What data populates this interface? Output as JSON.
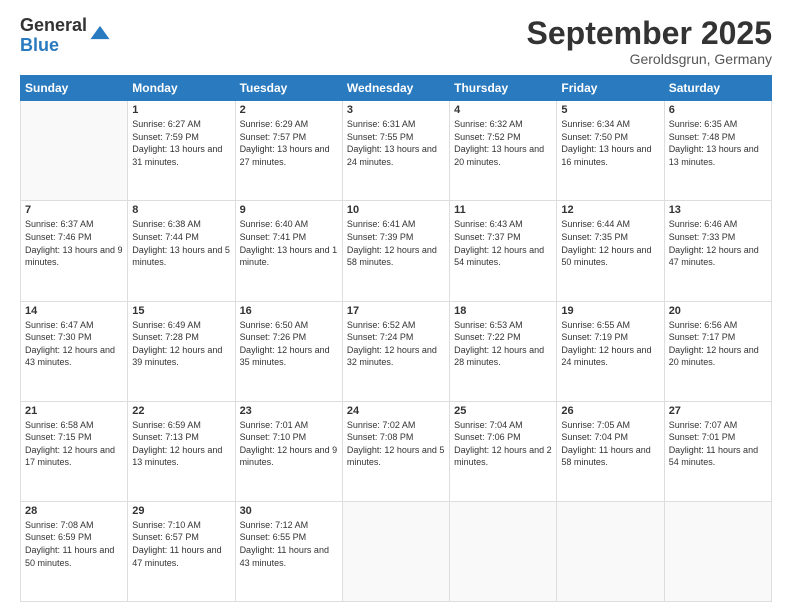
{
  "header": {
    "logo_general": "General",
    "logo_blue": "Blue",
    "month_title": "September 2025",
    "location": "Geroldsgrun, Germany"
  },
  "days_of_week": [
    "Sunday",
    "Monday",
    "Tuesday",
    "Wednesday",
    "Thursday",
    "Friday",
    "Saturday"
  ],
  "weeks": [
    [
      {
        "day": "",
        "info": ""
      },
      {
        "day": "1",
        "info": "Sunrise: 6:27 AM\nSunset: 7:59 PM\nDaylight: 13 hours and 31 minutes."
      },
      {
        "day": "2",
        "info": "Sunrise: 6:29 AM\nSunset: 7:57 PM\nDaylight: 13 hours and 27 minutes."
      },
      {
        "day": "3",
        "info": "Sunrise: 6:31 AM\nSunset: 7:55 PM\nDaylight: 13 hours and 24 minutes."
      },
      {
        "day": "4",
        "info": "Sunrise: 6:32 AM\nSunset: 7:52 PM\nDaylight: 13 hours and 20 minutes."
      },
      {
        "day": "5",
        "info": "Sunrise: 6:34 AM\nSunset: 7:50 PM\nDaylight: 13 hours and 16 minutes."
      },
      {
        "day": "6",
        "info": "Sunrise: 6:35 AM\nSunset: 7:48 PM\nDaylight: 13 hours and 13 minutes."
      }
    ],
    [
      {
        "day": "7",
        "info": "Sunrise: 6:37 AM\nSunset: 7:46 PM\nDaylight: 13 hours and 9 minutes."
      },
      {
        "day": "8",
        "info": "Sunrise: 6:38 AM\nSunset: 7:44 PM\nDaylight: 13 hours and 5 minutes."
      },
      {
        "day": "9",
        "info": "Sunrise: 6:40 AM\nSunset: 7:41 PM\nDaylight: 13 hours and 1 minute."
      },
      {
        "day": "10",
        "info": "Sunrise: 6:41 AM\nSunset: 7:39 PM\nDaylight: 12 hours and 58 minutes."
      },
      {
        "day": "11",
        "info": "Sunrise: 6:43 AM\nSunset: 7:37 PM\nDaylight: 12 hours and 54 minutes."
      },
      {
        "day": "12",
        "info": "Sunrise: 6:44 AM\nSunset: 7:35 PM\nDaylight: 12 hours and 50 minutes."
      },
      {
        "day": "13",
        "info": "Sunrise: 6:46 AM\nSunset: 7:33 PM\nDaylight: 12 hours and 47 minutes."
      }
    ],
    [
      {
        "day": "14",
        "info": "Sunrise: 6:47 AM\nSunset: 7:30 PM\nDaylight: 12 hours and 43 minutes."
      },
      {
        "day": "15",
        "info": "Sunrise: 6:49 AM\nSunset: 7:28 PM\nDaylight: 12 hours and 39 minutes."
      },
      {
        "day": "16",
        "info": "Sunrise: 6:50 AM\nSunset: 7:26 PM\nDaylight: 12 hours and 35 minutes."
      },
      {
        "day": "17",
        "info": "Sunrise: 6:52 AM\nSunset: 7:24 PM\nDaylight: 12 hours and 32 minutes."
      },
      {
        "day": "18",
        "info": "Sunrise: 6:53 AM\nSunset: 7:22 PM\nDaylight: 12 hours and 28 minutes."
      },
      {
        "day": "19",
        "info": "Sunrise: 6:55 AM\nSunset: 7:19 PM\nDaylight: 12 hours and 24 minutes."
      },
      {
        "day": "20",
        "info": "Sunrise: 6:56 AM\nSunset: 7:17 PM\nDaylight: 12 hours and 20 minutes."
      }
    ],
    [
      {
        "day": "21",
        "info": "Sunrise: 6:58 AM\nSunset: 7:15 PM\nDaylight: 12 hours and 17 minutes."
      },
      {
        "day": "22",
        "info": "Sunrise: 6:59 AM\nSunset: 7:13 PM\nDaylight: 12 hours and 13 minutes."
      },
      {
        "day": "23",
        "info": "Sunrise: 7:01 AM\nSunset: 7:10 PM\nDaylight: 12 hours and 9 minutes."
      },
      {
        "day": "24",
        "info": "Sunrise: 7:02 AM\nSunset: 7:08 PM\nDaylight: 12 hours and 5 minutes."
      },
      {
        "day": "25",
        "info": "Sunrise: 7:04 AM\nSunset: 7:06 PM\nDaylight: 12 hours and 2 minutes."
      },
      {
        "day": "26",
        "info": "Sunrise: 7:05 AM\nSunset: 7:04 PM\nDaylight: 11 hours and 58 minutes."
      },
      {
        "day": "27",
        "info": "Sunrise: 7:07 AM\nSunset: 7:01 PM\nDaylight: 11 hours and 54 minutes."
      }
    ],
    [
      {
        "day": "28",
        "info": "Sunrise: 7:08 AM\nSunset: 6:59 PM\nDaylight: 11 hours and 50 minutes."
      },
      {
        "day": "29",
        "info": "Sunrise: 7:10 AM\nSunset: 6:57 PM\nDaylight: 11 hours and 47 minutes."
      },
      {
        "day": "30",
        "info": "Sunrise: 7:12 AM\nSunset: 6:55 PM\nDaylight: 11 hours and 43 minutes."
      },
      {
        "day": "",
        "info": ""
      },
      {
        "day": "",
        "info": ""
      },
      {
        "day": "",
        "info": ""
      },
      {
        "day": "",
        "info": ""
      }
    ]
  ]
}
